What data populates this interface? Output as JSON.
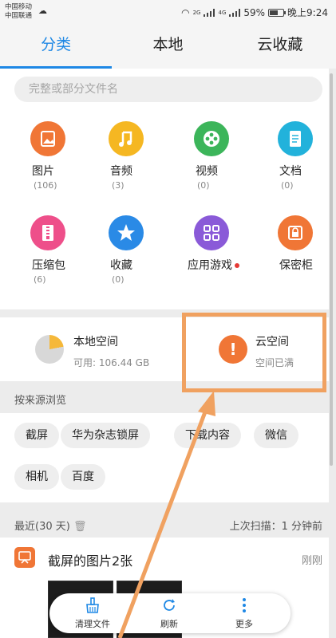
{
  "status_bar": {
    "carrier_1": "中国移动",
    "carrier_2": "中国联通",
    "battery": "59%",
    "time": "晚上9:24",
    "net_1": "2G",
    "net_2": "4G"
  },
  "tabs": [
    {
      "label": "分类",
      "active": true
    },
    {
      "label": "本地",
      "active": false
    },
    {
      "label": "云收藏",
      "active": false
    }
  ],
  "search": {
    "placeholder": "完整或部分文件名"
  },
  "categories": [
    {
      "label": "图片",
      "count": "(106)",
      "color": "#f07636",
      "icon": "image-icon"
    },
    {
      "label": "音频",
      "count": "(3)",
      "color": "#f5b722",
      "icon": "music-icon"
    },
    {
      "label": "视频",
      "count": "(0)",
      "color": "#3cb55a",
      "icon": "video-reel-icon"
    },
    {
      "label": "文档",
      "count": "(0)",
      "color": "#22b2db",
      "icon": "document-icon"
    },
    {
      "label": "压缩包",
      "count": "(6)",
      "color": "#ee4f8a",
      "icon": "archive-zipper-icon"
    },
    {
      "label": "收藏",
      "count": "(0)",
      "color": "#2a8ae6",
      "icon": "star-icon"
    },
    {
      "label": "应用游戏",
      "count": "",
      "color": "#8a5ad8",
      "icon": "apps-grid-icon"
    },
    {
      "label": "保密柜",
      "count": "",
      "color": "#f07636",
      "icon": "lock-safe-icon"
    }
  ],
  "storage": {
    "local_title": "本地空间",
    "local_sub": "可用: 106.44 GB",
    "local_used_fraction": 0.22,
    "cloud_title": "云空间",
    "cloud_sub": "空间已满",
    "cloud_icon_text": "!"
  },
  "source": {
    "header": "按来源浏览",
    "chips": [
      "截屏",
      "华为杂志锁屏",
      "下载内容",
      "微信",
      "相机",
      "百度"
    ]
  },
  "recent": {
    "header": "最近(30 天)",
    "scan": "上次扫描：1 分钟前",
    "item_title": "截屏的图片2张",
    "item_time": "刚刚"
  },
  "bottom_bar": {
    "clean": "清理文件",
    "refresh": "刷新",
    "more": "更多"
  },
  "colors": {
    "accent": "#1e88e5",
    "highlight": "#f0a160"
  }
}
